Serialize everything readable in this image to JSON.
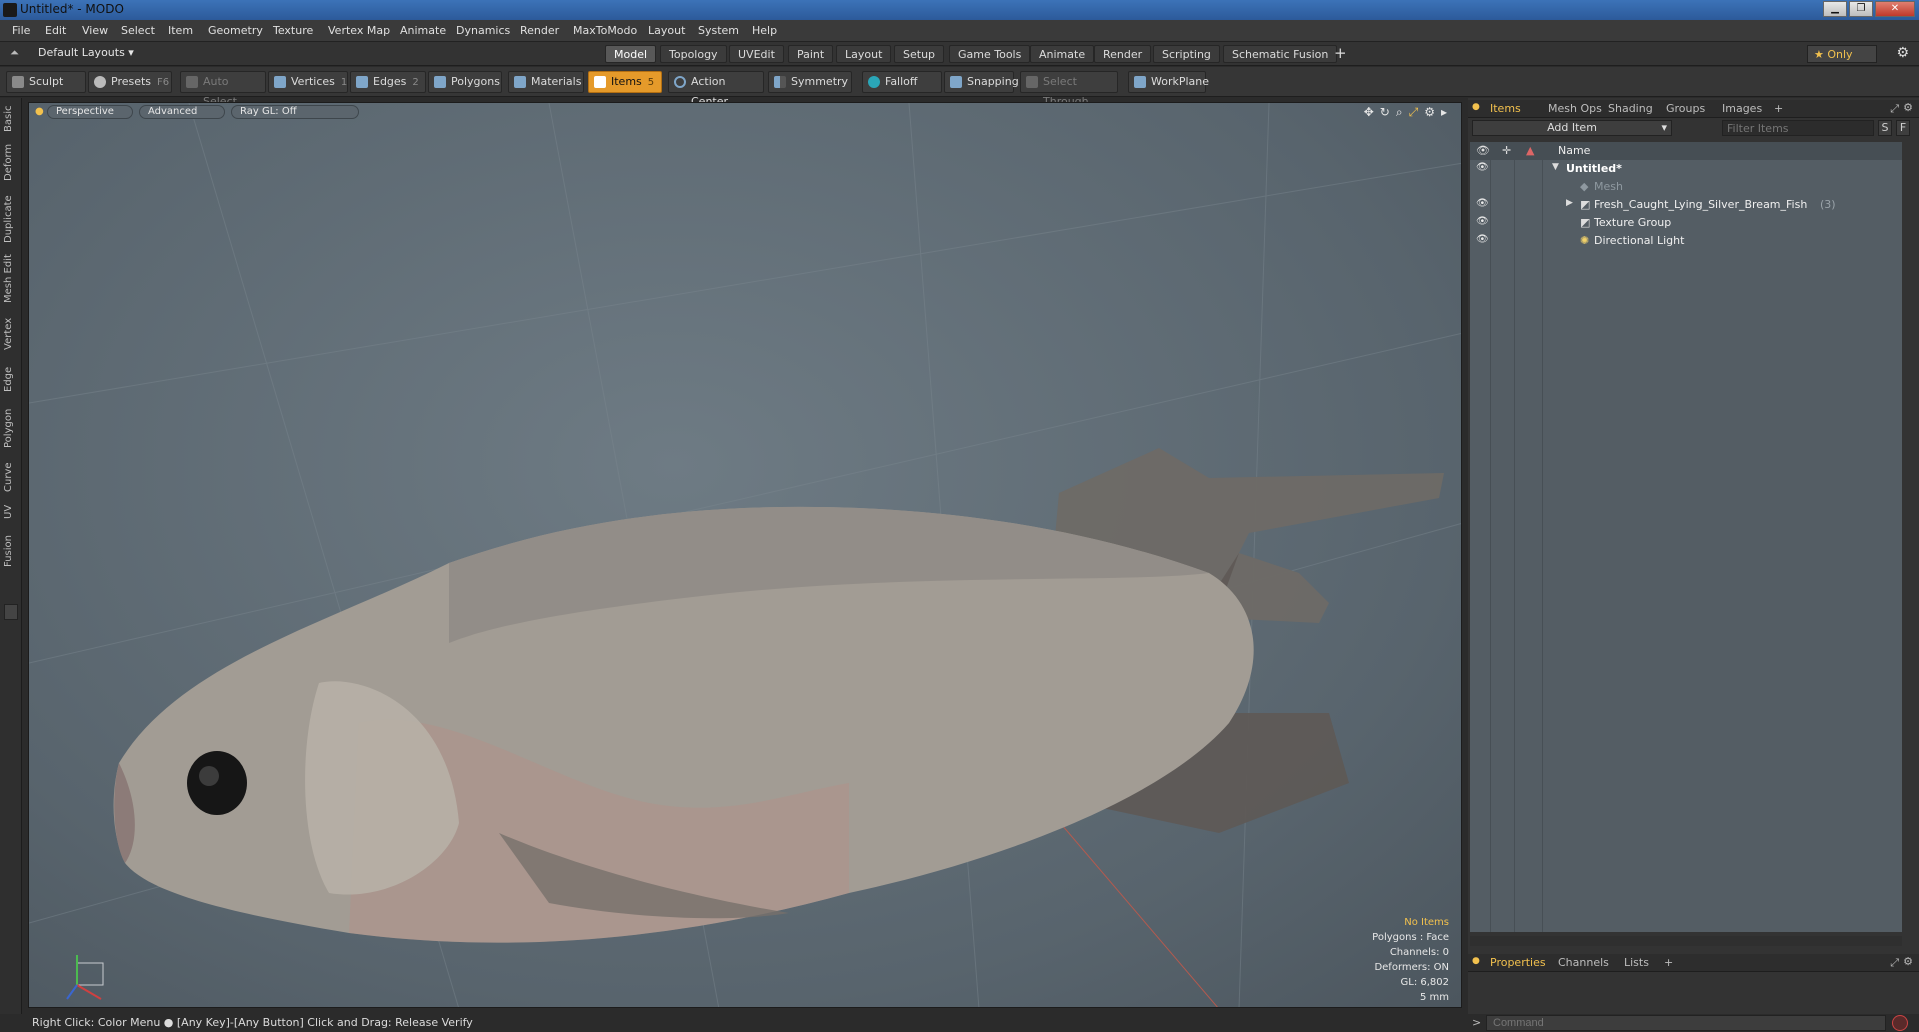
{
  "window": {
    "title": "Untitled* - MODO"
  },
  "menu": [
    "File",
    "Edit",
    "View",
    "Select",
    "Item",
    "Geometry",
    "Texture",
    "Vertex Map",
    "Animate",
    "Dynamics",
    "Render",
    "MaxToModo",
    "Layout",
    "System",
    "Help"
  ],
  "layouts": {
    "label": "Default Layouts ▾"
  },
  "mode_tabs": [
    "Model",
    "Topology",
    "UVEdit",
    "Paint",
    "Layout",
    "Setup",
    "Game Tools",
    "Animate",
    "Render",
    "Scripting",
    "Schematic Fusion"
  ],
  "mode_tabs_active": "Model",
  "only_button": "★  Only",
  "toolbar": {
    "sculpt": "Sculpt",
    "presets": "Presets",
    "presets_key": "F6",
    "auto_select": "Auto Select",
    "vertices": "Vertices",
    "vertices_key": "1",
    "edges": "Edges",
    "edges_key": "2",
    "polygons": "Polygons",
    "materials": "Materials",
    "items": "Items",
    "items_key": "5",
    "action_center": "Action Center",
    "symmetry": "Symmetry",
    "falloff": "Falloff",
    "snapping": "Snapping",
    "select_through": "Select Through",
    "workplane": "WorkPlane"
  },
  "left_tabs": [
    "Basic",
    "Deform",
    "Duplicate",
    "Mesh Edit",
    "Vertex",
    "Edge",
    "Polygon",
    "Curve",
    "UV",
    "Fusion"
  ],
  "viewport": {
    "view": "Perspective",
    "shading": "Advanced",
    "raygl": "Ray GL: Off",
    "stats": {
      "items": "No Items",
      "polygons": "Polygons : Face",
      "channels": "Channels: 0",
      "deformers": "Deformers: ON",
      "gl": "GL: 6,802",
      "scale": "5 mm"
    }
  },
  "items_panel": {
    "tabs": [
      "Items",
      "Mesh Ops",
      "Shading",
      "Groups",
      "Images"
    ],
    "add_item": "Add Item",
    "filter_placeholder": "Filter Items",
    "btn_s": "S",
    "btn_f": "F",
    "col_name": "Name",
    "rows": [
      {
        "label": "Untitled*"
      },
      {
        "label": "Mesh"
      },
      {
        "label": "Fresh_Caught_Lying_Silver_Bream_Fish",
        "count": "(3)"
      },
      {
        "label": "Texture Group"
      },
      {
        "label": "Directional Light"
      }
    ]
  },
  "properties_panel": {
    "tabs": [
      "Properties",
      "Channels",
      "Lists"
    ]
  },
  "status": {
    "text": "Right Click: Color Menu ● [Any Key]-[Any Button] Click and Drag: Release Verify"
  },
  "command": {
    "placeholder": "Command"
  }
}
